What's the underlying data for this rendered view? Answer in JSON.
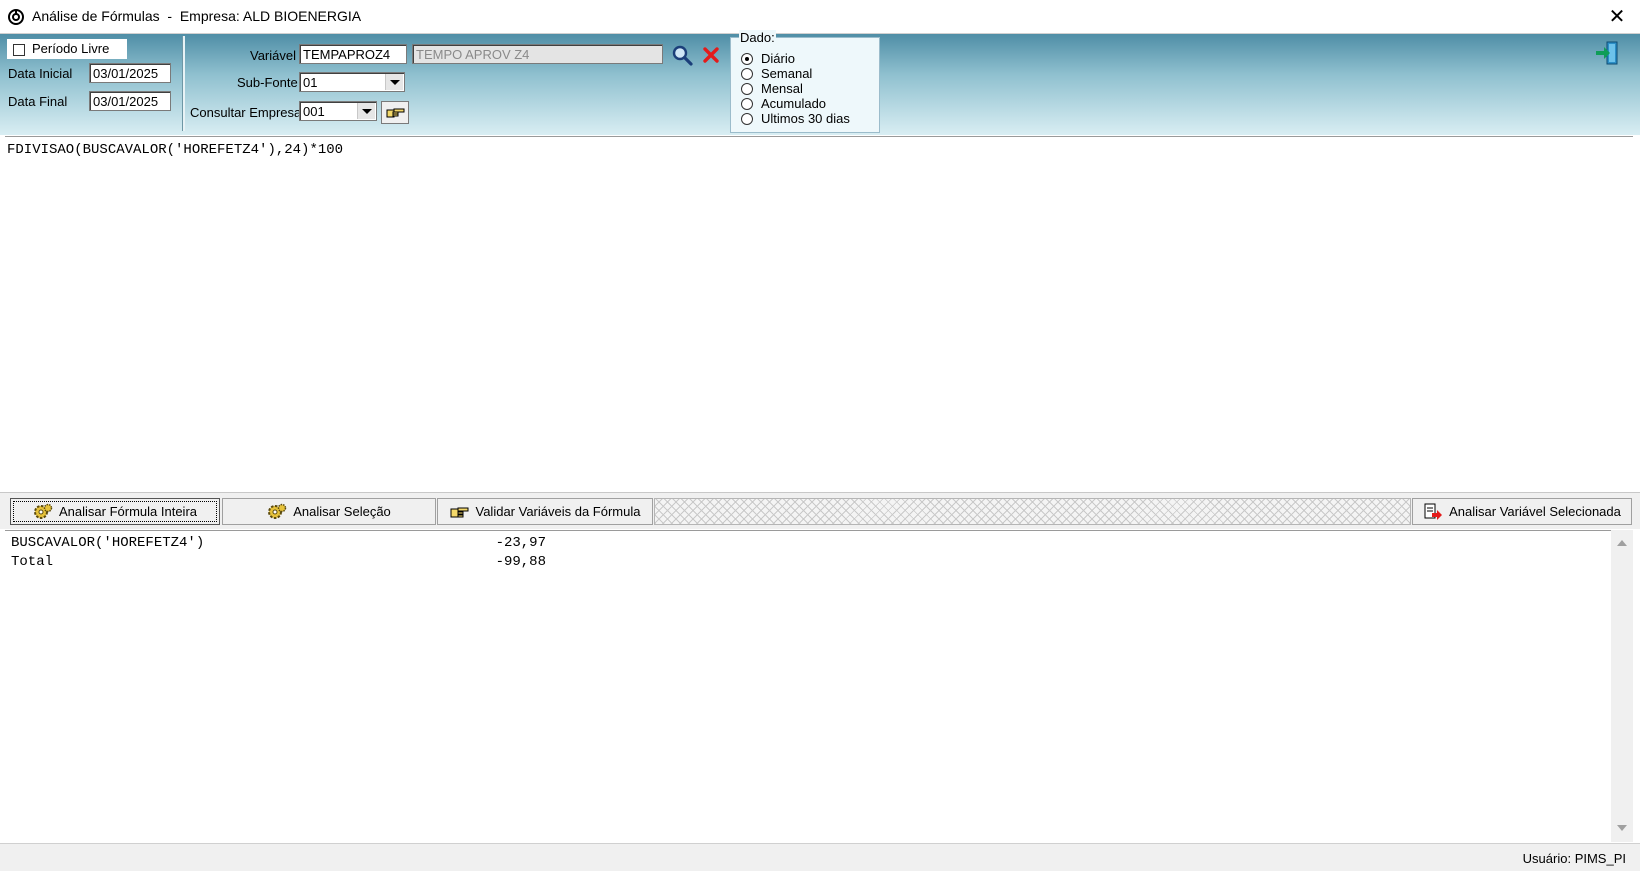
{
  "window": {
    "title": "Análise de Fórmulas  -  Empresa: ALD BIOENERGIA",
    "close_label": "✕"
  },
  "filters": {
    "periodo_livre_label": "Período Livre",
    "periodo_livre_checked": false,
    "data_inicial_label": "Data Inicial",
    "data_inicial_value": "03/01/2025",
    "data_final_label": "Data Final",
    "data_final_value": "03/01/2025",
    "variavel_label": "Variável",
    "variavel_code": "TEMPAPROZ4",
    "variavel_desc": "TEMPO APROV Z4",
    "subfonte_label": "Sub-Fonte",
    "subfonte_value": "01",
    "consultar_empresa_label": "Consultar Empresa",
    "consultar_empresa_value": "001"
  },
  "dado": {
    "legend": "Dado:",
    "options": [
      "Diário",
      "Semanal",
      "Mensal",
      "Acumulado",
      "Ultimos 30 dias"
    ],
    "selected": "Diário"
  },
  "formula": "FDIVISAO(BUSCAVALOR('HOREFETZ4'),24)*100",
  "toolbar": {
    "analisar_formula": "Analisar Fórmula Inteira",
    "analisar_selecao": "Analisar Seleção",
    "validar_variaveis": "Validar Variáveis da Fórmula",
    "analisar_variavel": "Analisar Variável Selecionada"
  },
  "results": [
    {
      "label": "BUSCAVALOR('HOREFETZ4')",
      "value": "-23,97"
    },
    {
      "label": "Total",
      "value": "-99,88"
    }
  ],
  "status": {
    "user": "Usuário: PIMS_PI"
  },
  "icons": {
    "title": "app-logo-icon",
    "search": "search-icon",
    "clear": "clear-red-x-icon",
    "exit": "exit-door-icon",
    "consult": "hand-pointer-icon",
    "gears": "gears-icon",
    "validate": "checklist-hand-icon",
    "analyze_var": "document-arrow-icon"
  },
  "colors": {
    "header_gradient_top": "#4f8ea6",
    "header_gradient_bottom": "#d9eef3",
    "clear_icon": "#e31b1b"
  }
}
